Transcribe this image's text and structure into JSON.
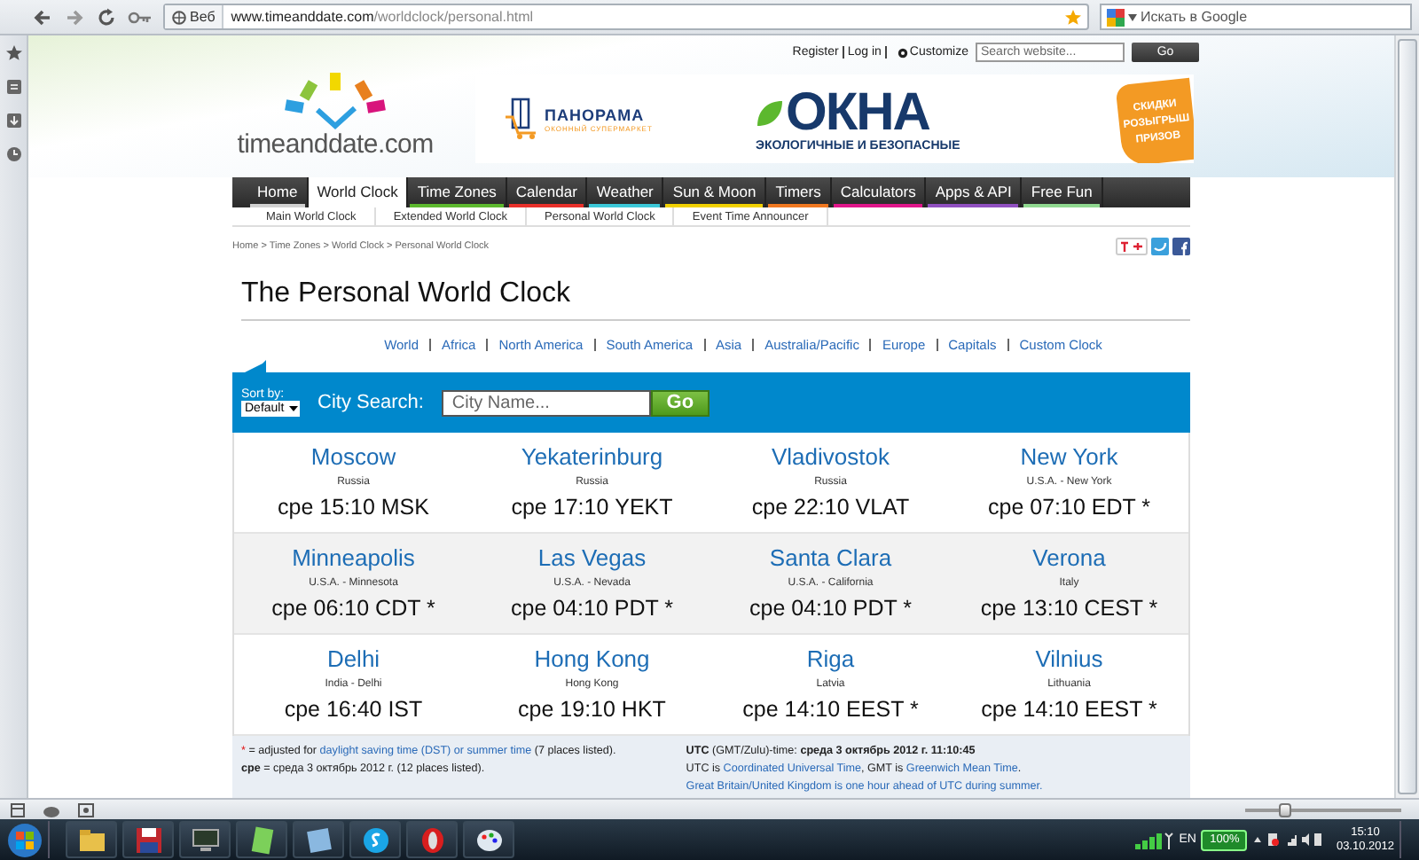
{
  "browser": {
    "address_button": "Веб",
    "url_host": "www.timeanddate.com",
    "url_path": "/worldclock/personal.html",
    "search": {
      "placeholder": "Искать в Google"
    }
  },
  "header": {
    "account_links": [
      "Register",
      "Log in"
    ],
    "customize": "Customize",
    "search": {
      "placeholder": "Search website..."
    },
    "go_button": "Go",
    "logo": "timeanddate.com"
  },
  "ad": {
    "brand": "ПАНОРАМА",
    "brand_tagline": "ОКОННЫЙ СУПЕРМАРКЕТ",
    "headline": "ОКНА",
    "subline": "ЭКОЛОГИЧНЫЕ И БЕЗОПАСНЫЕ",
    "badge": "СКИДКИ РОЗЫГРЫШ ПРИЗОВ"
  },
  "nav": [
    {
      "label": "Home",
      "selected": false,
      "color": "#d0d0d0"
    },
    {
      "label": "World Clock",
      "selected": true
    },
    {
      "label": "Time Zones",
      "selected": false,
      "color": "#5cb82e"
    },
    {
      "label": "Calendar",
      "selected": false,
      "color": "#e8302a"
    },
    {
      "label": "Weather",
      "selected": false,
      "color": "#3cc8d8"
    },
    {
      "label": "Sun & Moon",
      "selected": false,
      "color": "#f0d000"
    },
    {
      "label": "Timers",
      "selected": false,
      "color": "#f07820"
    },
    {
      "label": "Calculators",
      "selected": false,
      "color": "#e0168a"
    },
    {
      "label": "Apps & API",
      "selected": false,
      "color": "#9050c0"
    },
    {
      "label": "Free Fun",
      "selected": false,
      "color": "#90d890"
    }
  ],
  "subnav": [
    "Main World Clock",
    "Extended World Clock",
    "Personal World Clock",
    "Event Time Announcer"
  ],
  "breadcrumb": "Home > Time Zones > World Clock > Personal World Clock",
  "title": "The Personal World Clock",
  "regions": [
    "World",
    "Africa",
    "North America",
    "South America",
    "Asia",
    "Australia/Pacific",
    "Europe",
    "Capitals",
    "Custom Clock"
  ],
  "toolbar": {
    "sort_label": "Sort by:",
    "sort_value": "Default",
    "search_label": "City Search:",
    "search": {
      "placeholder": "City Name..."
    },
    "go_button": "Go"
  },
  "cities": [
    {
      "name": "Moscow",
      "place": "Russia",
      "time": "сре 15:10 MSK"
    },
    {
      "name": "Yekaterinburg",
      "place": "Russia",
      "time": "сре 17:10 YEKT"
    },
    {
      "name": "Vladivostok",
      "place": "Russia",
      "time": "сре 22:10 VLAT"
    },
    {
      "name": "New York",
      "place": "U.S.A. - New York",
      "time": "сре 07:10 EDT *"
    },
    {
      "name": "Minneapolis",
      "place": "U.S.A. - Minnesota",
      "time": "сре 06:10 CDT *"
    },
    {
      "name": "Las Vegas",
      "place": "U.S.A. - Nevada",
      "time": "сре 04:10 PDT *"
    },
    {
      "name": "Santa Clara",
      "place": "U.S.A. - California",
      "time": "сре 04:10 PDT *"
    },
    {
      "name": "Verona",
      "place": "Italy",
      "time": "сре 13:10 CEST *"
    },
    {
      "name": "Delhi",
      "place": "India - Delhi",
      "time": "сре 16:40 IST"
    },
    {
      "name": "Hong Kong",
      "place": "Hong Kong",
      "time": "сре 19:10 HKT"
    },
    {
      "name": "Riga",
      "place": "Latvia",
      "time": "сре 14:10 EEST *"
    },
    {
      "name": "Vilnius",
      "place": "Lithuania",
      "time": "сре 14:10 EEST *"
    }
  ],
  "footer": {
    "dst_note": [
      {
        "text": "*",
        "kind": "mark"
      },
      {
        "text": " = adjusted for ",
        "kind": "plain"
      },
      {
        "text": "daylight saving time (DST) or summer time",
        "kind": "link"
      },
      {
        "text": " (7 places listed).",
        "kind": "plain"
      }
    ],
    "day_note": "**сре** = среда 3 октябрь 2012 г. (12 places listed).",
    "utc_time": "**UTC** (GMT/Zulu)-time: **среда 3 октябрь 2012 г. 11:10:45**",
    "utc_note": [
      {
        "text": "UTC is ",
        "kind": "plain"
      },
      {
        "text": "Coordinated Universal Time",
        "kind": "link"
      },
      {
        "text": ", GMT is ",
        "kind": "plain"
      },
      {
        "text": "Greenwich Mean Time",
        "kind": "link"
      },
      {
        "text": ".",
        "kind": "plain"
      }
    ],
    "uk_note": "Great Britain/United Kingdom is one hour ahead of UTC during summer."
  },
  "status_bar": {
    "zoom_slider": {
      "level": 0.25
    }
  },
  "taskbar": {
    "language": "EN",
    "battery": "100%",
    "time": "15:10",
    "date": "03.10.2012"
  }
}
